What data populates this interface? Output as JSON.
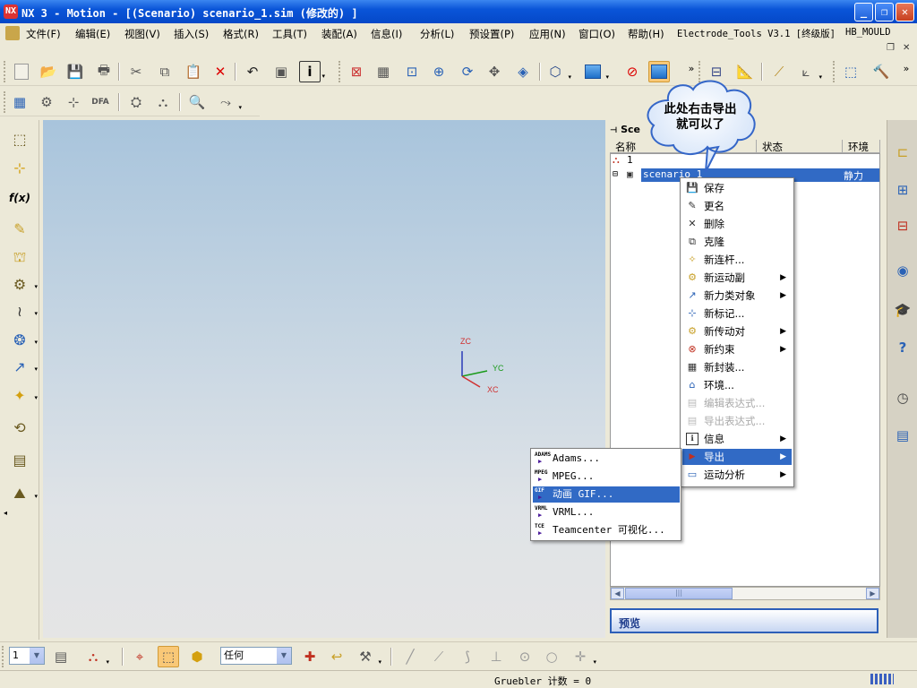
{
  "window": {
    "title": "NX 3 - Motion - [(Scenario) scenario_1.sim  (修改的) ]",
    "logo": "NX",
    "controls": {
      "minimize": "_",
      "restore": "❐",
      "close": "✕"
    }
  },
  "menubar": {
    "items": [
      "文件(F)",
      "编辑(E)",
      "视图(V)",
      "插入(S)",
      "格式(R)",
      "工具(T)",
      "装配(A)",
      "信息(I)",
      "分析(L)",
      "预设置(P)",
      "应用(N)",
      "窗口(O)",
      "帮助(H)",
      "Electrode_Tools V3.1 [终级版]",
      "HB_MOULD"
    ],
    "mdi_controls": {
      "restore": "❐",
      "close": "✕"
    }
  },
  "toolbar_main": {
    "overflow": "»",
    "icons": [
      "new-icon",
      "open-icon",
      "save-icon",
      "print-icon",
      "cut-icon",
      "copy-icon",
      "paste-icon",
      "delete-icon",
      "undo-icon",
      "copy-display-icon",
      "info-icon",
      "fit-icon",
      "zoom-area-icon",
      "zoom-icon",
      "rotate-icon",
      "pan-icon",
      "view-icon",
      "shaded-icon",
      "display-icon",
      "hide-icon",
      "motion-cube-icon",
      "measure-icon",
      "ruler-icon",
      "analysis-icon",
      "curve-icon",
      "export-icon",
      "tools-icon"
    ]
  },
  "toolbar_second": {
    "dfa_label": "DFA"
  },
  "left_toolbar": {
    "expression_label": "f(x)",
    "overflow": "◂"
  },
  "viewport": {
    "triad": {
      "z": "ZC",
      "y": "YC",
      "x": "XC"
    }
  },
  "navigator": {
    "title": "Sce",
    "columns": [
      "名称",
      "状态",
      "环境"
    ],
    "rows": [
      {
        "name": "1",
        "expander": "",
        "environment": ""
      },
      {
        "name": "scenario_1",
        "expander": "⊟",
        "environment": "静力和…"
      }
    ],
    "scroll_left": "◀",
    "scroll_right": "▶",
    "scroll_thumb": "|||",
    "preview_label": "预览"
  },
  "callout": {
    "text_line1": "此处右击导出",
    "text_line2": "就可以了"
  },
  "context_menu": {
    "items": [
      {
        "label": "保存",
        "icon": "save-icon",
        "glyph": "💾",
        "submenu": false,
        "disabled": false
      },
      {
        "label": "更名",
        "icon": "rename-icon",
        "glyph": "✎",
        "submenu": false,
        "disabled": false
      },
      {
        "label": "删除",
        "icon": "delete-icon",
        "glyph": "✕",
        "submenu": false,
        "disabled": false
      },
      {
        "label": "克隆",
        "icon": "clone-icon",
        "glyph": "⧉",
        "submenu": false,
        "disabled": false
      },
      {
        "label": "新连杆...",
        "icon": "link-icon",
        "glyph": "✧",
        "submenu": false,
        "disabled": false
      },
      {
        "label": "新运动副",
        "icon": "joint-icon",
        "glyph": "⚙",
        "submenu": true,
        "disabled": false
      },
      {
        "label": "新力类对象",
        "icon": "force-icon",
        "glyph": "↗",
        "submenu": true,
        "disabled": false
      },
      {
        "label": "新标记...",
        "icon": "marker-icon",
        "glyph": "⊹",
        "submenu": false,
        "disabled": false
      },
      {
        "label": "新传动对",
        "icon": "gear-icon",
        "glyph": "⚙",
        "submenu": true,
        "disabled": false
      },
      {
        "label": "新约束",
        "icon": "constraint-icon",
        "glyph": "⊗",
        "submenu": true,
        "disabled": false
      },
      {
        "label": "新封装...",
        "icon": "package-icon",
        "glyph": "▦",
        "submenu": false,
        "disabled": false
      },
      {
        "label": "环境...",
        "icon": "environment-icon",
        "glyph": "⌂",
        "submenu": false,
        "disabled": false
      },
      {
        "label": "编辑表达式...",
        "icon": "edit-expression-icon",
        "glyph": "▤",
        "submenu": false,
        "disabled": true
      },
      {
        "label": "导出表达式...",
        "icon": "export-expression-icon",
        "glyph": "▤",
        "submenu": false,
        "disabled": true
      },
      {
        "label": "信息",
        "icon": "info-icon",
        "glyph": "ℹ",
        "submenu": true,
        "disabled": false
      },
      {
        "label": "导出",
        "icon": "export-arrow-icon",
        "glyph": "▶",
        "submenu": true,
        "disabled": false,
        "selected": true
      },
      {
        "label": "运动分析",
        "icon": "motion-analysis-icon",
        "glyph": "▭",
        "submenu": true,
        "disabled": false
      }
    ],
    "submenu_arrow": "▶"
  },
  "export_submenu": {
    "items": [
      {
        "label": "Adams...",
        "tag": "ADAMS"
      },
      {
        "label": "MPEG...",
        "tag": "MPEG"
      },
      {
        "label": "动画 GIF...",
        "tag": "GIF",
        "selected": true
      },
      {
        "label": "VRML...",
        "tag": "VRML"
      },
      {
        "label": "Teamcenter 可视化...",
        "tag": "TCE"
      }
    ]
  },
  "bottom_toolbar": {
    "layer_value": "1",
    "filter_value": "任何",
    "dropdown_arrow": "▼"
  },
  "statusbar": {
    "text": "Gruebler 计数 = 0"
  }
}
